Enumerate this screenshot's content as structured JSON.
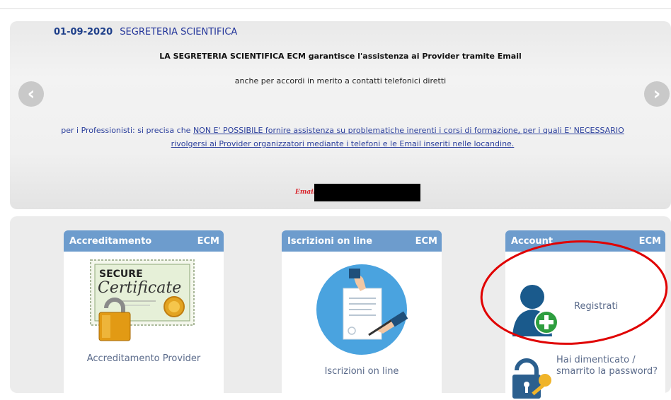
{
  "news": {
    "date": "01-09-2020",
    "title": "SEGRETERIA SCIENTIFICA",
    "line1": "LA SEGRETERIA SCIENTIFICA ECM garantisce l'assistenza ai Provider tramite Email",
    "line2": "anche per accordi in merito a contatti telefonici diretti",
    "line3_a": "per i Professionisti: si precisa che ",
    "line3_b": "NON E' POSSIBILE fornire assistenza su problematiche inerenti i corsi di formazione, per i quali E' NECESSARIO rivolgersi ai Provider organizzatori mediante i telefoni e le Email inseriti nelle locandine.",
    "email_label": "Email"
  },
  "slider": {
    "prev_icon": "chevron-left-icon",
    "next_icon": "chevron-right-icon"
  },
  "cards": [
    {
      "title": "Accreditamento",
      "badge": "ECM",
      "link": "Accreditamento Provider",
      "cert_secure": "SECURE",
      "cert_word": "Certificate"
    },
    {
      "title": "Iscrizioni on line",
      "badge": "ECM",
      "link": "Iscrizioni on line"
    },
    {
      "title": "Account",
      "badge": "ECM",
      "register": "Registrati",
      "forgot": "Hai dimenticato / smarrito la password?"
    }
  ],
  "colors": {
    "card_header": "#6d9ccd",
    "link_text": "#5a6a8a",
    "news_blue": "#2b3f9c",
    "annotation": "#e00000"
  }
}
